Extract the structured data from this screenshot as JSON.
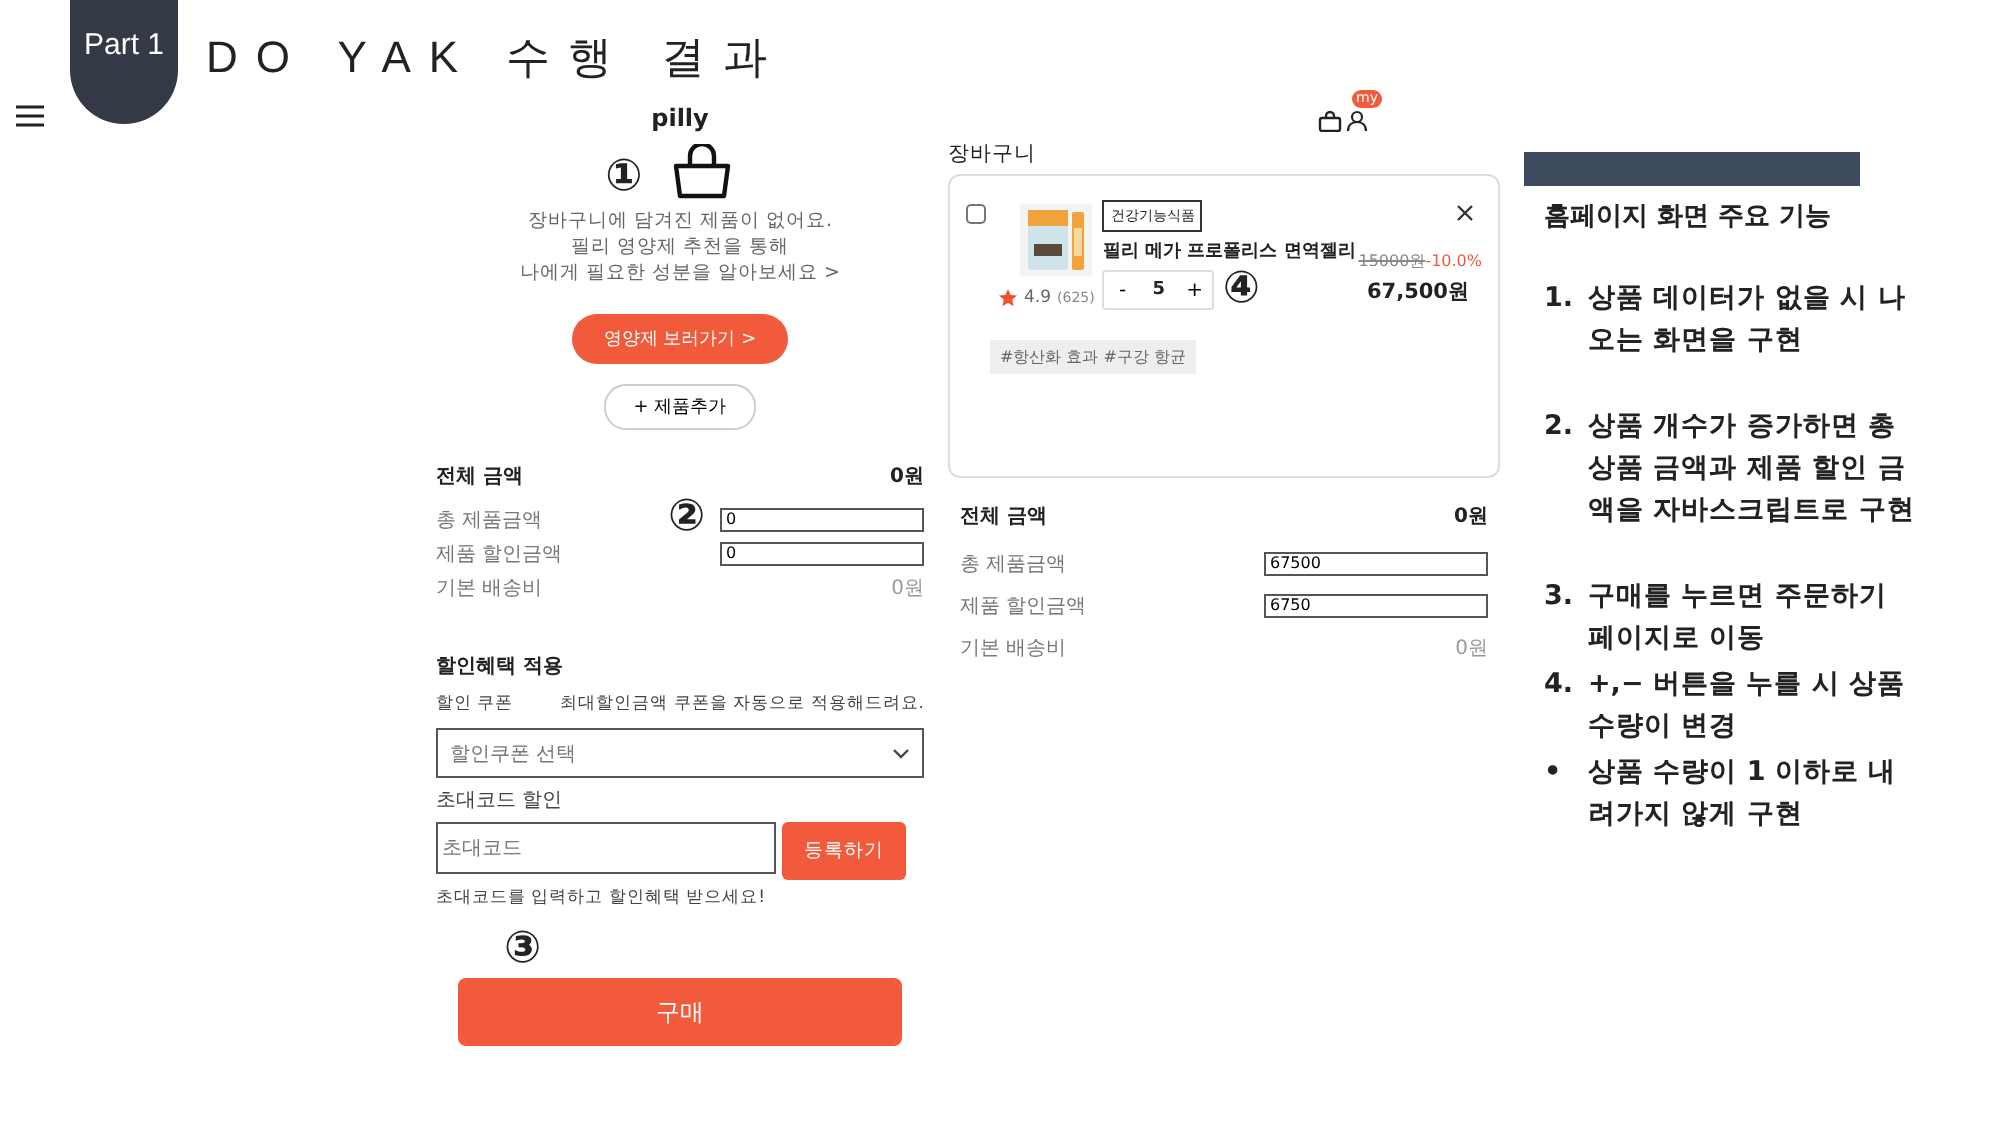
{
  "slide": {
    "part_label": "Part 1",
    "title": "DO YAK 수행 결과"
  },
  "empty_cart_screen": {
    "logo": "pilly",
    "marker": "①",
    "message": [
      "장바구니에 담겨진 제품이 없어요.",
      "필리 영양제 추천을 통해",
      "나에게 필요한 성분을 알아보세요 >"
    ],
    "cta_button": "영양제 보러가기 >",
    "add_button": "+ 제품추가",
    "summary": {
      "title": "전체 금액",
      "total": "0원",
      "marker": "②",
      "rows": [
        {
          "label": "총 제품금액",
          "kind": "field",
          "value": "0"
        },
        {
          "label": "제품 할인금액",
          "kind": "field",
          "value": "0"
        },
        {
          "label": "기본 배송비",
          "kind": "text",
          "value": "0원"
        }
      ]
    },
    "discount": {
      "title": "할인혜택 적용",
      "coupon_label": "할인 쿠폰",
      "coupon_note": "최대할인금액 쿠폰을 자동으로 적용해드려요.",
      "coupon_select": "할인쿠폰 선택",
      "referral_label": "초대코드 할인",
      "referral_placeholder": "초대코드",
      "register_button": "등록하기",
      "referral_hint": "초대코드를 입력하고 할인혜택 받으세요!"
    },
    "purchase_button": "구매",
    "purchase_marker": "③"
  },
  "cart_screen": {
    "badge": "my",
    "heading": "장바구니",
    "item": {
      "checked": false,
      "tag": "건강기능식품",
      "name": "필리 메가 프로폴리스 면역젤리",
      "minus": "-",
      "quantity": "5",
      "plus": "+",
      "marker": "④",
      "rating": "4.9",
      "reviews": "(625)",
      "original_price": "15000원",
      "discount": "-10.0%",
      "price": "67,500원",
      "hashtags": "#항산화 효과 #구강 항균"
    },
    "summary": {
      "title": "전체 금액",
      "total": "0원",
      "rows": [
        {
          "label": "총 제품금액",
          "kind": "field",
          "value": "67500"
        },
        {
          "label": "제품 할인금액",
          "kind": "field",
          "value": "6750"
        },
        {
          "label": "기본 배송비",
          "kind": "text",
          "value": "0원"
        }
      ]
    }
  },
  "notes": {
    "heading": "홈페이지 화면 주요 기능",
    "items": [
      {
        "marker": "1.",
        "text": "상품 데이터가 없을 시 나오는 화면을 구현"
      },
      {
        "marker": "2.",
        "text": "상품 개수가 증가하면 총 상품 금액과 제품 할인 금액을 자바스크립트로 구현"
      },
      {
        "marker": "3.",
        "text": "구매를 누르면 주문하기 페이지로 이동"
      },
      {
        "marker": "4.",
        "text": "+,− 버튼을 누를 시 상품 수량이 변경"
      },
      {
        "marker": "•",
        "text": "상품 수량이 1 이하로 내려가지 않게 구현"
      }
    ]
  }
}
